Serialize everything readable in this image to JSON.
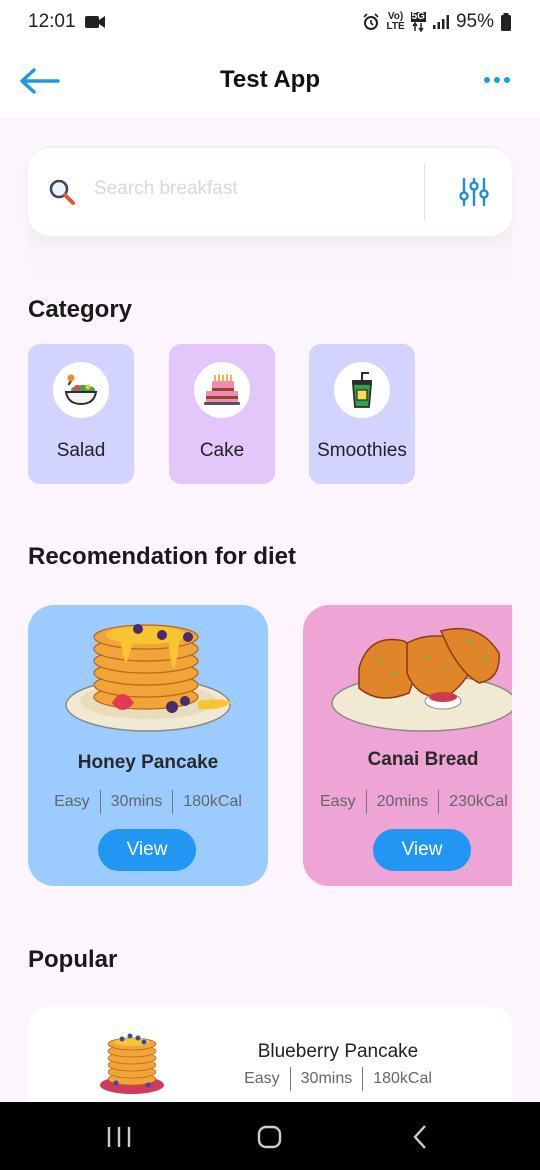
{
  "status_bar": {
    "time": "12:01",
    "volte_top": "Vo)",
    "volte_bottom": "LTE",
    "network": "5G",
    "battery": "95%"
  },
  "app_bar": {
    "title": "Test App",
    "back_icon": "arrow-left-icon",
    "more_icon": "more-horizontal-icon"
  },
  "search": {
    "placeholder": "Search breakfast",
    "value": "",
    "icon": "search-icon",
    "filter_icon": "filter-sliders-icon"
  },
  "categories": {
    "title": "Category",
    "items": [
      {
        "label": "Salad",
        "icon": "salad-icon",
        "color": "#d3d3ff"
      },
      {
        "label": "Cake",
        "icon": "cake-icon",
        "color": "#e3c7fa"
      },
      {
        "label": "Smoothies",
        "icon": "smoothie-icon",
        "color": "#d3d3ff"
      }
    ]
  },
  "recommendation": {
    "title": "Recomendation for diet",
    "items": [
      {
        "name": "Honey Pancake",
        "level": "Easy",
        "time": "30mins",
        "calories": "180kCal",
        "button": "View",
        "color": "#9ccbff"
      },
      {
        "name": "Canai Bread",
        "level": "Easy",
        "time": "20mins",
        "calories": "230kCal",
        "button": "View",
        "color": "#eea5d5"
      }
    ]
  },
  "popular": {
    "title": "Popular",
    "items": [
      {
        "name": "Blueberry Pancake",
        "level": "Easy",
        "time": "30mins",
        "calories": "180kCal"
      }
    ]
  },
  "colors": {
    "accent": "#2196f3",
    "background": "#fdf5fd"
  }
}
